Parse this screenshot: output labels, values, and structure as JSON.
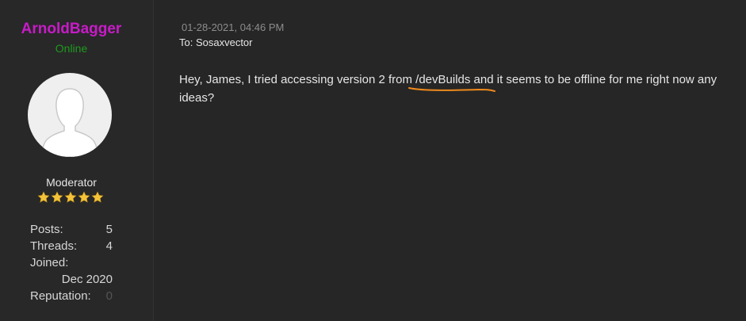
{
  "author": {
    "username": "ArnoldBagger",
    "status": "Online",
    "role": "Moderator",
    "rating_stars": 5,
    "stats": [
      {
        "label": "Posts:",
        "value": "5"
      },
      {
        "label": "Threads:",
        "value": "4"
      },
      {
        "label": "Joined:",
        "value": "Dec 2020"
      },
      {
        "label": "Reputation:",
        "value": "0"
      }
    ]
  },
  "post": {
    "date": "01-28-2021, 04:46 PM",
    "to": "To: Sosaxvector",
    "body_before": "Hey, James, I tried accessing version 2 from ",
    "body_highlight": "/devBuilds",
    "body_after": " and it seems to be offline for me right now any ideas?"
  },
  "colors": {
    "username": "#c81bc8",
    "online": "#1f9a1f",
    "star": "#f3c33a",
    "highlight_underline": "#f08a1c"
  },
  "icons": {
    "avatar": "default-user-icon",
    "star": "star-icon"
  }
}
